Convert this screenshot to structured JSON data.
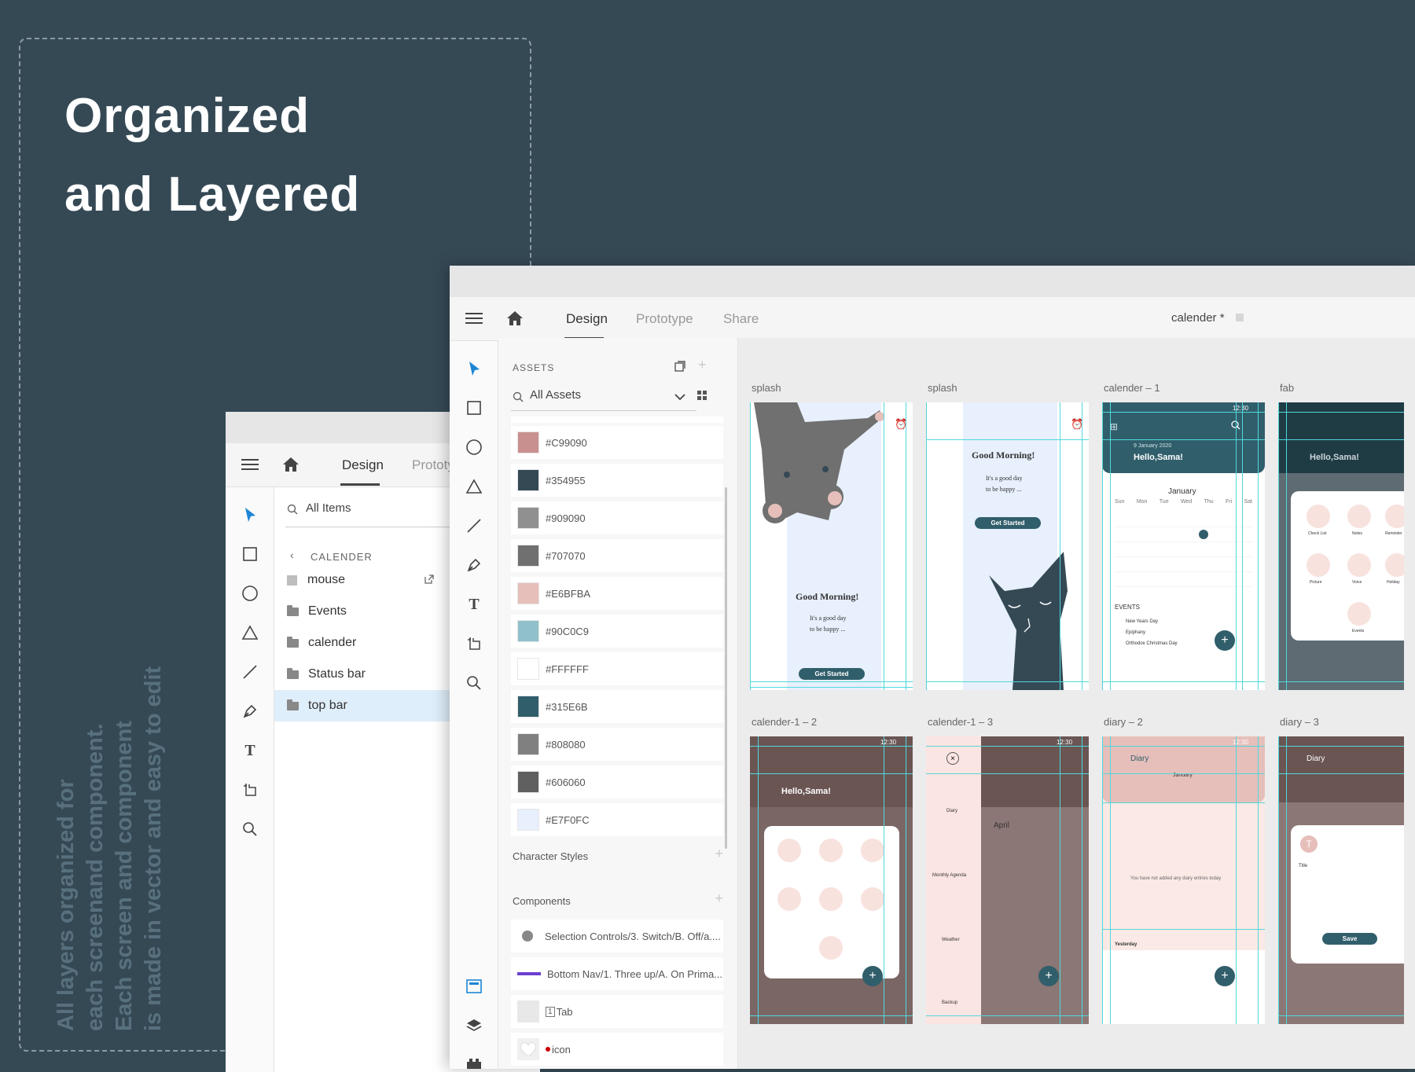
{
  "headline": {
    "line1": "Organized",
    "line2": "and Layered"
  },
  "sidenote": {
    "line1": "All layers organized for",
    "line2": "each screenand component.",
    "line3": "Each screen and component",
    "line4": "is made in vector and easy to edit"
  },
  "back_window": {
    "tabs": [
      "Design",
      "Prototype"
    ],
    "search_label": "All Items",
    "section_title": "CALENDER",
    "layers": [
      "mouse",
      "Events",
      "calender",
      "Status bar",
      "top bar"
    ]
  },
  "front_window": {
    "tabs": [
      "Design",
      "Prototype",
      "Share"
    ],
    "doc_title": "calender *",
    "assets_title": "ASSETS",
    "assets_filter": "All Assets",
    "colors": [
      {
        "hex": "#C99090",
        "label": "#C99090"
      },
      {
        "hex": "#354955",
        "label": "#354955"
      },
      {
        "hex": "#909090",
        "label": "#909090"
      },
      {
        "hex": "#707070",
        "label": "#707070"
      },
      {
        "hex": "#E6BFBA",
        "label": "#E6BFBA"
      },
      {
        "hex": "#90C0C9",
        "label": "#90C0C9"
      },
      {
        "hex": "#FFFFFF",
        "label": "#FFFFFF"
      },
      {
        "hex": "#315E6B",
        "label": "#315E6B"
      },
      {
        "hex": "#808080",
        "label": "#808080"
      },
      {
        "hex": "#606060",
        "label": "#606060"
      },
      {
        "hex": "#E7F0FC",
        "label": "#E7F0FC"
      }
    ],
    "character_styles_label": "Character Styles",
    "components_label": "Components",
    "components": [
      "Selection Controls/3. Switch/B. Off/a....",
      "Bottom Nav/1. Three up/A. On Prima...",
      "Tab",
      "icon"
    ]
  },
  "artboards": {
    "row1": [
      "splash",
      "splash",
      "calender – 1",
      "fab"
    ],
    "row2": [
      "calender-1 – 2",
      "calender-1 – 3",
      "diary – 2",
      "diary – 3"
    ]
  },
  "artboard_text": {
    "good_morning": "Good Morning!",
    "tagline1": "It's a good day",
    "tagline2": "to be happy ...",
    "get_started": "Get Started",
    "time": "12:30",
    "date": "9 January 2020",
    "hello": "Hello,Sama!",
    "month": "January",
    "weekdays": [
      "Sun",
      "Mon",
      "Tue",
      "Wed",
      "Thu",
      "Fri",
      "Sat"
    ],
    "events": "EVENTS",
    "event1": "New Years Day",
    "event2": "Epiphany",
    "event3": "Orthodox Christmas Day",
    "april": "April",
    "menu_items": [
      "Check List",
      "Notes",
      "Reminder",
      "Picture",
      "Voice",
      "Holiday",
      "Events"
    ],
    "drawer_items": [
      "Diary",
      "Monthly Agenda",
      "Weather",
      "Backup"
    ],
    "diary": "Diary",
    "no_entries": "You have not added any diary entries today",
    "yesterday": "Yesterday",
    "title": "Title",
    "save": "Save"
  }
}
